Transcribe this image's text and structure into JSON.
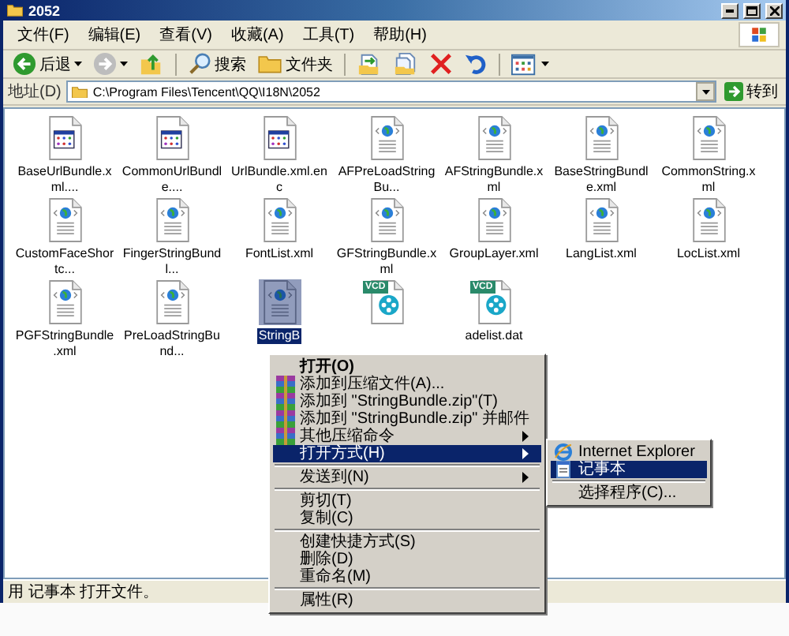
{
  "window": {
    "title": "2052"
  },
  "menu": [
    "文件(F)",
    "编辑(E)",
    "查看(V)",
    "收藏(A)",
    "工具(T)",
    "帮助(H)"
  ],
  "toolbar": [
    {
      "kind": "back",
      "label": "后退"
    },
    {
      "kind": "forward"
    },
    {
      "kind": "up"
    },
    {
      "kind": "search",
      "label": "搜索"
    },
    {
      "kind": "folders",
      "label": "文件夹"
    },
    {
      "kind": "move"
    },
    {
      "kind": "copy"
    },
    {
      "kind": "delete"
    },
    {
      "kind": "undo"
    },
    {
      "kind": "views"
    }
  ],
  "address": {
    "label": "地址(D)",
    "value": "C:\\Program Files\\Tencent\\QQ\\I18N\\2052",
    "go": "转到"
  },
  "files": [
    {
      "name": "BaseUrlBundle.xml....",
      "kind": "app",
      "selected": false
    },
    {
      "name": "CommonUrlBundle....",
      "kind": "app",
      "selected": false
    },
    {
      "name": "UrlBundle.xml.enc",
      "kind": "app",
      "selected": false
    },
    {
      "name": "AFPreLoadStringBu...",
      "kind": "xml",
      "selected": false
    },
    {
      "name": "AFStringBundle.xml",
      "kind": "xml",
      "selected": false
    },
    {
      "name": "BaseStringBundle.xml",
      "kind": "xml",
      "selected": false
    },
    {
      "name": "CommonString.xml",
      "kind": "xml",
      "selected": false
    },
    {
      "name": "CustomFaceShortc...",
      "kind": "xml",
      "selected": false
    },
    {
      "name": "FingerStringBundl...",
      "kind": "xml",
      "selected": false
    },
    {
      "name": "FontList.xml",
      "kind": "xml",
      "selected": false
    },
    {
      "name": "GFStringBundle.xml",
      "kind": "xml",
      "selected": false
    },
    {
      "name": "GroupLayer.xml",
      "kind": "xml",
      "selected": false
    },
    {
      "name": "LangList.xml",
      "kind": "xml",
      "selected": false
    },
    {
      "name": "LocList.xml",
      "kind": "xml",
      "selected": false
    },
    {
      "name": "PGFStringBundle.xml",
      "kind": "xml",
      "selected": false
    },
    {
      "name": "PreLoadStringBund...",
      "kind": "xml",
      "selected": false
    },
    {
      "name": "StringB",
      "kind": "xml",
      "selected": true
    },
    {
      "kind": "vcd",
      "badge": "VCD",
      "selected": false
    },
    {
      "name": "adelist.dat",
      "kind": "vcd",
      "badge": "VCD",
      "selected": false
    }
  ],
  "context_menu": {
    "items": [
      {
        "kind": "default",
        "label": "打开(O)",
        "selected": false
      },
      {
        "kind": "archive",
        "label": "添加到压缩文件(A)...",
        "selected": false
      },
      {
        "kind": "archive",
        "label": "添加到 \"StringBundle.zip\"(T)",
        "selected": false
      },
      {
        "kind": "archive",
        "label": "添加到 \"StringBundle.zip\" 并邮件",
        "selected": false
      },
      {
        "kind": "archive",
        "label": "其他压缩命令",
        "submenu": true,
        "selected": false
      },
      {
        "kind": "item",
        "label": "打开方式(H)",
        "submenu": true,
        "selected": true
      },
      {
        "kind": "separator"
      },
      {
        "kind": "item",
        "label": "发送到(N)",
        "submenu": true,
        "selected": false
      },
      {
        "kind": "separator"
      },
      {
        "kind": "item",
        "label": "剪切(T)",
        "selected": false
      },
      {
        "kind": "item",
        "label": "复制(C)",
        "selected": false
      },
      {
        "kind": "separator"
      },
      {
        "kind": "item",
        "label": "创建快捷方式(S)",
        "selected": false
      },
      {
        "kind": "item",
        "label": "删除(D)",
        "selected": false
      },
      {
        "kind": "item",
        "label": "重命名(M)",
        "selected": false
      },
      {
        "kind": "separator"
      },
      {
        "kind": "item",
        "label": "属性(R)",
        "selected": false
      }
    ]
  },
  "submenu": {
    "items": [
      {
        "kind": "browser",
        "label": "Internet Explorer",
        "selected": false
      },
      {
        "kind": "notepad",
        "label": "记事本",
        "selected": true
      },
      {
        "kind": "separator"
      },
      {
        "kind": "item",
        "label": "选择程序(C)...",
        "selected": false
      }
    ]
  },
  "status_bar": "用 记事本 打开文件。"
}
